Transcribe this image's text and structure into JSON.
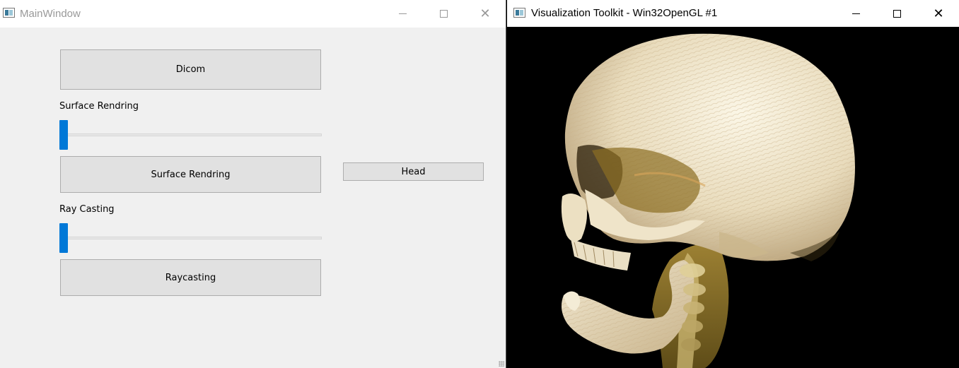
{
  "main_window": {
    "title": "MainWindow",
    "buttons": {
      "dicom": "Dicom",
      "surface_rendering": "Surface Rendring",
      "raycasting": "Raycasting",
      "head": "Head"
    },
    "labels": {
      "surface": "Surface Rendring",
      "ray": "Ray Casting"
    },
    "sliders": {
      "surface_value": 0,
      "ray_value": 0
    }
  },
  "vtk_window": {
    "title": "Visualization Toolkit - Win32OpenGL #1",
    "view": "volume-rendered-skull"
  },
  "colors": {
    "accent": "#0078d7",
    "button_bg": "#e1e1e1",
    "window_bg": "#f0f0f0",
    "render_bg": "#000000",
    "bone": "#efe6cf",
    "tissue": "#a88a2e"
  }
}
